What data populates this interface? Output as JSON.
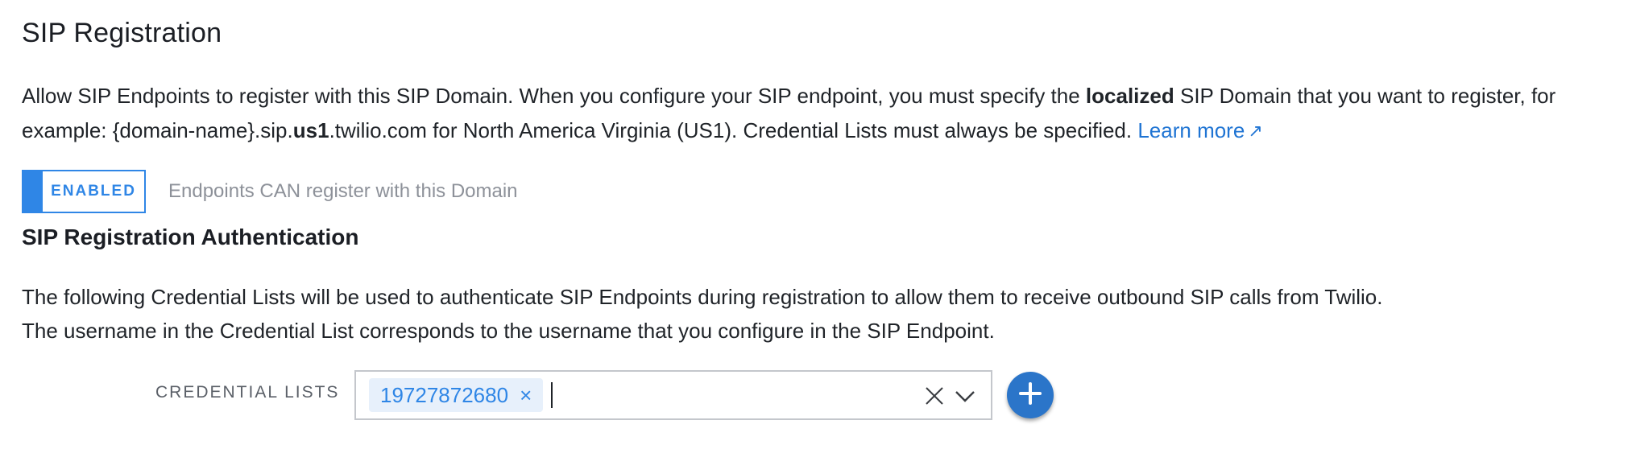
{
  "header": {
    "title": "SIP Registration"
  },
  "description": {
    "part1": "Allow SIP Endpoints to register with this SIP Domain. When you configure your SIP endpoint, you must specify the ",
    "bold1": "localized",
    "part2": " SIP Domain that you want to register, for example: {domain-name}.sip.",
    "bold2": "us1",
    "part3": ".twilio.com for North America Virginia (US1). Credential Lists must always be specified. ",
    "learn_more": "Learn more",
    "learn_more_icon": "external-link-arrow-icon"
  },
  "registration_toggle": {
    "state_label": "ENABLED",
    "description": "Endpoints CAN register with this Domain",
    "accent_color": "#2f86e6"
  },
  "authentication": {
    "title": "SIP Registration Authentication",
    "line1": "The following Credential Lists will be used to authenticate SIP Endpoints during registration to allow them to receive outbound SIP calls from Twilio.",
    "line2": "The username in the Credential List corresponds to the username that you configure in the SIP Endpoint."
  },
  "credential_lists": {
    "label": "CREDENTIAL LISTS",
    "selected": [
      "19727872680"
    ],
    "clear_icon": "close-icon",
    "dropdown_icon": "chevron-down-icon",
    "add_icon": "plus-icon",
    "add_button_color": "#2b75c9"
  }
}
